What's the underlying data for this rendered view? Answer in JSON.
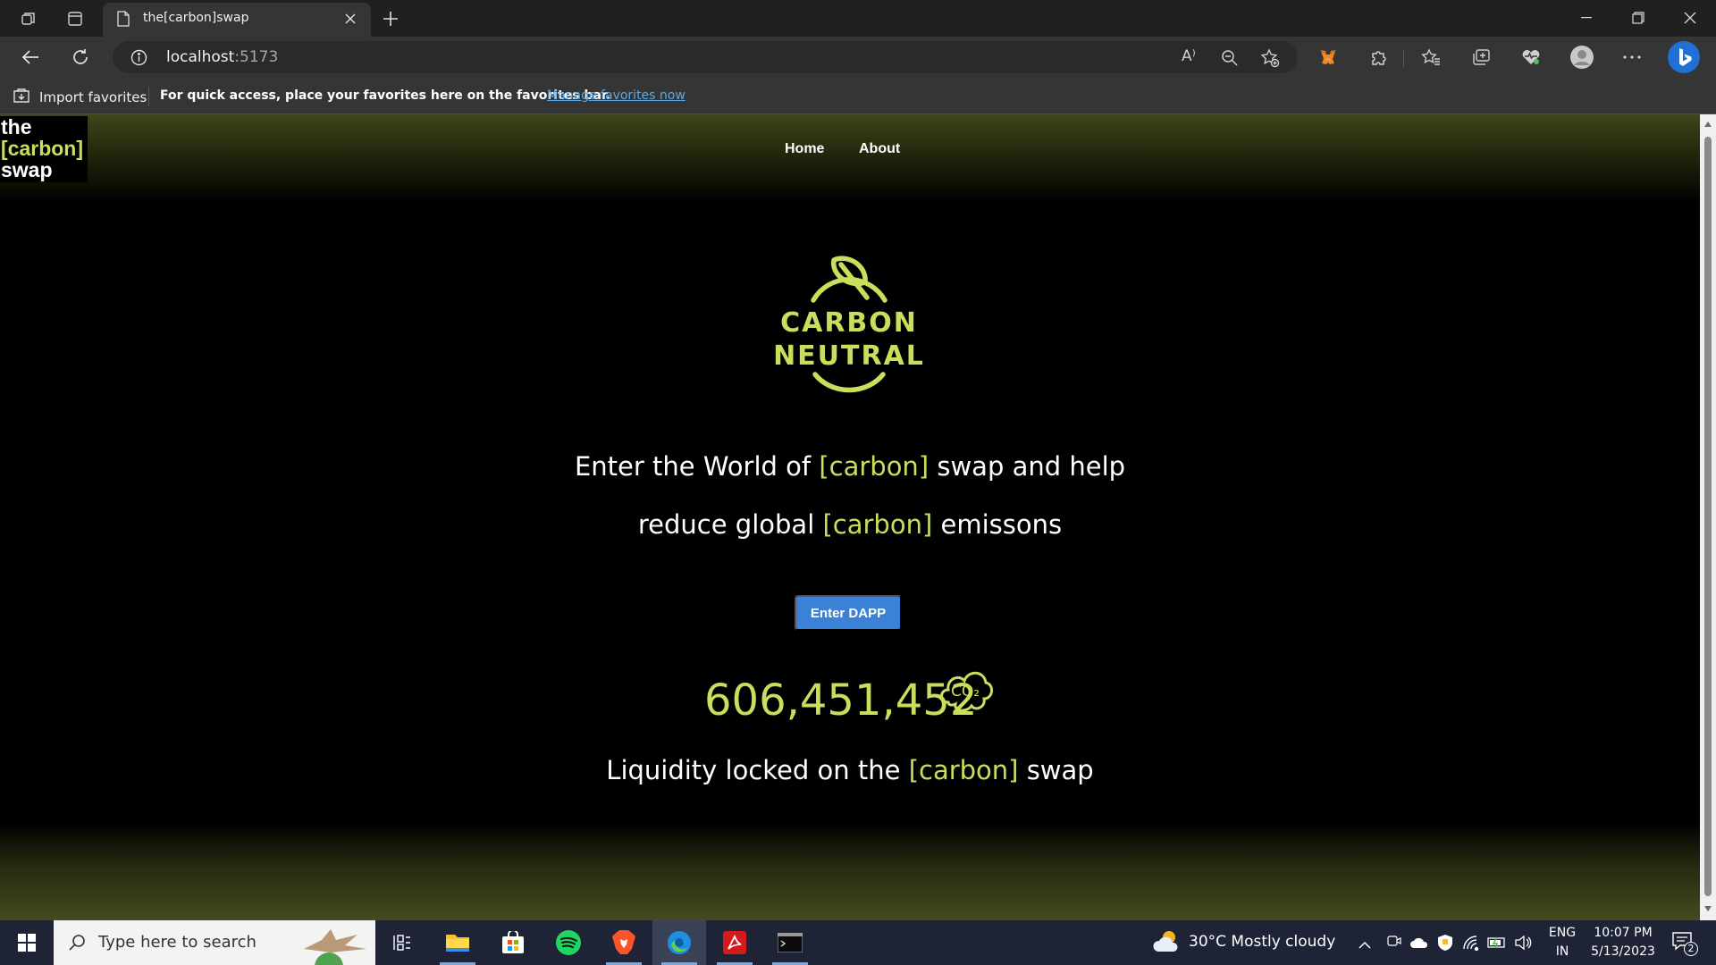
{
  "browser": {
    "tab_title": "the[carbon]swap",
    "url_host": "localhost",
    "url_port": ":5173",
    "read_aloud_label": "A⁾",
    "favorites_bar": {
      "import_label": "Import favorites",
      "message": "For quick access, place your favorites here on the favorites bar.",
      "manage_link": "Manage favorites now"
    }
  },
  "site": {
    "logo": {
      "line1": "the",
      "line2": "[carbon]",
      "line3": "swap"
    },
    "nav": [
      {
        "label": "Home"
      },
      {
        "label": "About"
      }
    ],
    "emblem": {
      "line1": "CARBON",
      "line2": "NEUTRAL"
    },
    "hero": {
      "line1_a": "Enter the World of ",
      "line1_accent": "[carbon]",
      "line1_b": " swap and help",
      "line2_a": "reduce global ",
      "line2_accent": "[carbon]",
      "line2_b": " emissons"
    },
    "cta_label": "Enter DAPP",
    "counter_value": "606,451,452",
    "co2_label": "CO₂",
    "liquidity": {
      "prefix": "Liquidity locked on the ",
      "accent": "[carbon]",
      "suffix": " swap"
    }
  },
  "taskbar": {
    "search_placeholder": "Type here to search",
    "weather": "30°C  Mostly cloudy",
    "lang_top": "ENG",
    "lang_bottom": "IN",
    "time": "10:07 PM",
    "date": "5/13/2023",
    "notification_count": "2"
  },
  "colors": {
    "accent": "#c9de5c",
    "cta": "#3b82d6",
    "background": "#000000"
  }
}
